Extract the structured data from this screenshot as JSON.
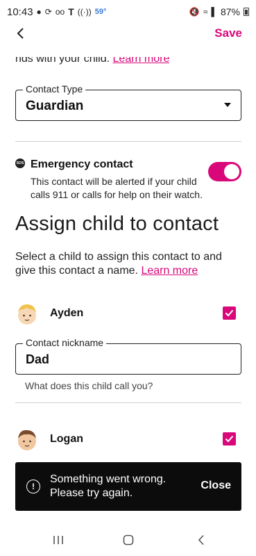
{
  "status_bar": {
    "time": "10:43",
    "carrier_icon": "tmobile-t-icon",
    "weather": "59°",
    "battery": "87%"
  },
  "header": {
    "save_label": "Save"
  },
  "cut_text": {
    "text": "nds with your child.",
    "link": "Learn more"
  },
  "contact_type": {
    "label": "Contact Type",
    "value": "Guardian"
  },
  "emergency": {
    "sos_icon_text": "SOS",
    "title": "Emergency contact",
    "description": "This contact will be alerted if your child calls 911 or calls for help on their watch.",
    "enabled": true
  },
  "assign": {
    "heading": "Assign child to contact",
    "description": "Select a child to assign this contact to and give this contact a name.",
    "link": "Learn more"
  },
  "children": [
    {
      "name": "Ayden",
      "checked": true,
      "nickname_label": "Contact nickname",
      "nickname_value": "Dad",
      "helper": "What does this child call you?"
    },
    {
      "name": "Logan",
      "checked": true
    }
  ],
  "snackbar": {
    "message": "Something went wrong. Please try again.",
    "close_label": "Close"
  },
  "colors": {
    "accent": "#d9087a",
    "snackbar_bg": "#0c0c0c"
  }
}
